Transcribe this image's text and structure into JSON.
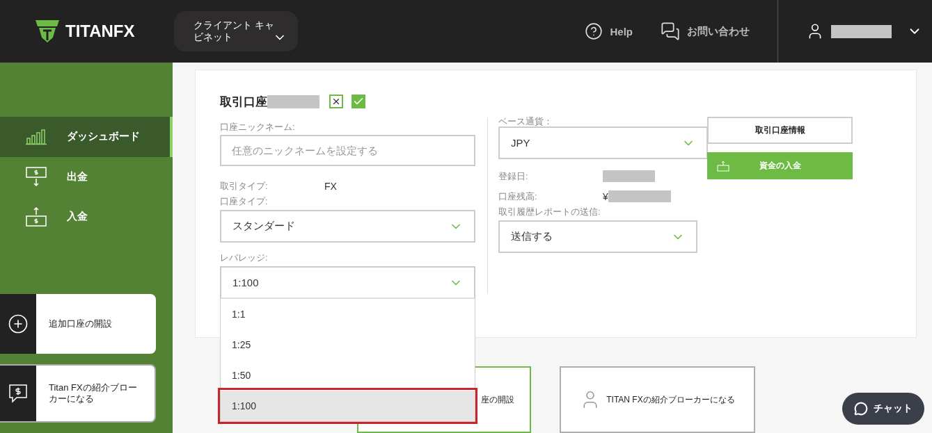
{
  "header": {
    "logo": "TITANFX",
    "cabinet_menu": {
      "label": "クライアント キャビネット"
    },
    "help": "Help",
    "contact": "お問い合わせ"
  },
  "sidebar": {
    "items": [
      {
        "label": "ダッシュボード",
        "kind": "chart",
        "selected": true
      },
      {
        "label": "出金",
        "kind": "withdraw",
        "selected": false
      },
      {
        "label": "入金",
        "kind": "deposit",
        "selected": false
      }
    ],
    "cards": [
      {
        "label": "追加口座の開設",
        "kind": "plus"
      },
      {
        "label": "Titan FXの紹介ブローカーになる",
        "kind": "speech"
      }
    ]
  },
  "account": {
    "title": "取引口座",
    "nickname": {
      "label": "口座ニックネーム:",
      "placeholder": "任意のニックネームを設定する"
    },
    "trade_type": {
      "label": "取引タイプ:",
      "value": "FX"
    },
    "account_type": {
      "label": "口座タイプ:",
      "value": "スタンダード"
    },
    "leverage": {
      "label": "レバレッジ:",
      "value": "1:100",
      "expanded": true,
      "options": [
        {
          "label": "1:1",
          "selected": false
        },
        {
          "label": "1:25",
          "selected": false
        },
        {
          "label": "1:50",
          "selected": false
        },
        {
          "label": "1:100",
          "selected": true
        }
      ]
    },
    "base_currency": {
      "label": "ベース通貨：",
      "value": "JPY"
    },
    "registered": {
      "label": "登録日:"
    },
    "balance": {
      "label": "口座残高:",
      "value": "¥"
    },
    "report": {
      "label": "取引履歴レポートの送信:",
      "value": "送信する"
    },
    "buttons": [
      {
        "label": "取引口座情報",
        "kind": "outline"
      },
      {
        "label": "資金の入金",
        "kind": "primary"
      }
    ]
  },
  "bottom_cards": [
    {
      "label": "座の開設",
      "kind": "green"
    },
    {
      "label": "TITAN FXの紹介ブローカーになる",
      "kind": "person"
    }
  ],
  "chat": {
    "label": "チャット"
  }
}
